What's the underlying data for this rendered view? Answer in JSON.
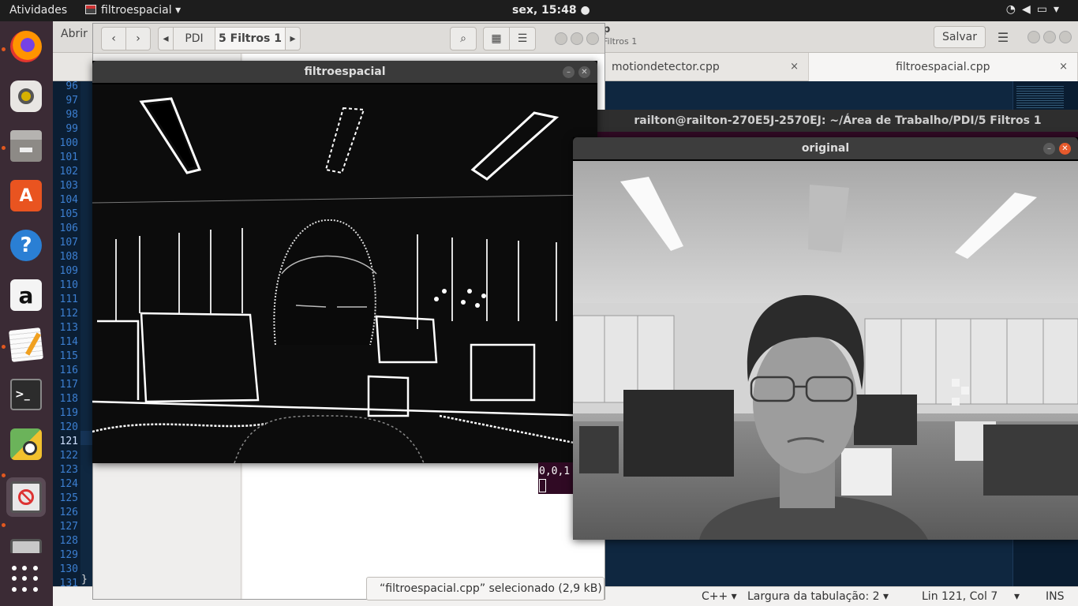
{
  "topbar": {
    "activities": "Atividades",
    "app_name": "filtroespacial",
    "clock": "sex, 15:48",
    "system_icons": [
      "wifi-icon",
      "volume-icon",
      "battery-icon",
      "menu-arrow-icon"
    ]
  },
  "dock": {
    "items": [
      "firefox-icon",
      "rhythmbox-icon",
      "files-icon",
      "software-center-icon",
      "help-icon",
      "amazon-icon",
      "text-editor-icon",
      "terminal-icon",
      "image-viewer-icon",
      "opencv-app-icon",
      "show-apps-icon"
    ],
    "amazon_glyph": "a",
    "help_glyph": "?",
    "software_glyph": "A",
    "terminal_glyph": ">_"
  },
  "gedit": {
    "open_label": "Abrir",
    "title_fragment": "p",
    "subtitle_fragment": "Filtros 1",
    "save_label": "Salvar",
    "tabs": [
      {
        "label": "motiondetector.cpp",
        "close": "×"
      },
      {
        "label": "filtroespacial.cpp",
        "close": "×"
      }
    ],
    "line_numbers": [
      "96",
      "97",
      "98",
      "99",
      "100",
      "101",
      "102",
      "103",
      "104",
      "105",
      "106",
      "107",
      "108",
      "109",
      "110",
      "111",
      "112",
      "113",
      "114",
      "115",
      "116",
      "117",
      "118",
      "119",
      "120",
      "121",
      "122",
      "123",
      "124",
      "125",
      "126",
      "127",
      "128",
      "129",
      "130",
      "131"
    ],
    "current_line": "121",
    "last_line_text": "}",
    "status": {
      "language": "C++ ▾",
      "tab_width": "Largura da tabulação: 2 ▾",
      "position": "Lin 121, Col 7",
      "position_arrow": "▾",
      "mode": "INS"
    }
  },
  "files": {
    "path": [
      "PDI",
      "5 Filtros 1"
    ],
    "status": "“filtroespacial.cpp” selecionado  (2,9 kB)"
  },
  "terminal": {
    "title": "railton@railton-270E5J-2570EJ: ~/Área de Trabalho/PDI/5 Filtros 1",
    "output": "0,0,1"
  },
  "windows": {
    "filtered": {
      "title": "filtroespacial"
    },
    "original": {
      "title": "original"
    }
  },
  "colors": {
    "topbar": "#1d1d1d",
    "dock": "#3b2b35",
    "editor_bg": "#0f2740",
    "line_number": "#3c7fd1",
    "terminal_bg": "#300a24",
    "close_button": "#e65a2c"
  }
}
